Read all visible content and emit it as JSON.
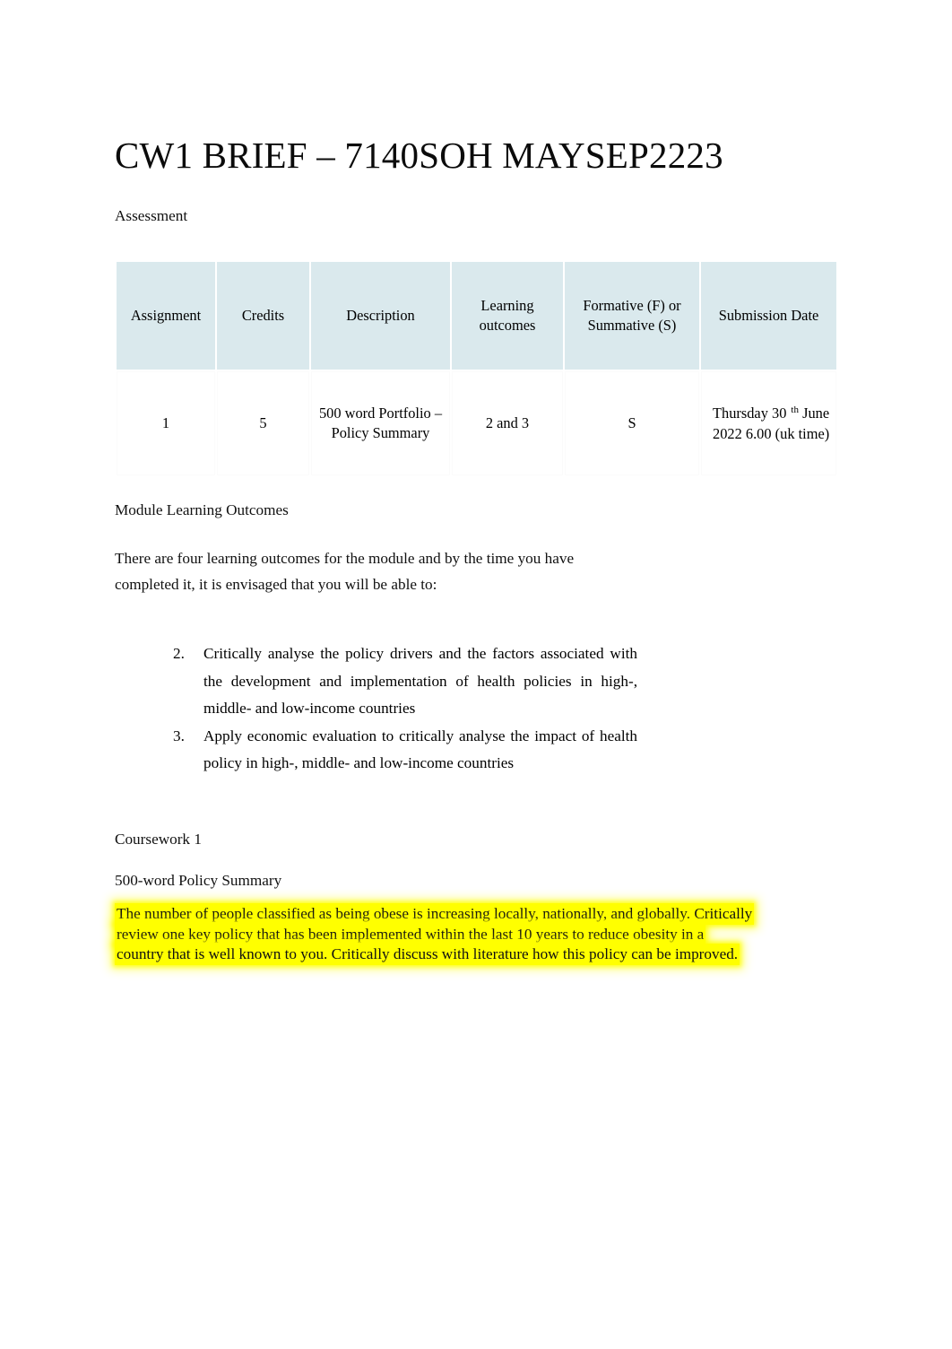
{
  "document": {
    "title": "CW1 BRIEF – 7140SOH MAYSEP2223",
    "section_assessment_label": "Assessment",
    "section_mlo_heading": "Module Learning Outcomes",
    "intro_paragraph": "There are four learning outcomes for the module and by the time you have completed it, it is envisaged that you will be able to:",
    "coursework_label": "Coursework 1",
    "policy_summary_label": "500-word Policy Summary",
    "brief_text": "The number of people classified as being obese is increasing locally, nationally, and globally. Critically review one key policy that has been implemented within the last 10 years to reduce obesity in a country that is well known to you. Critically discuss with literature how this policy can be improved."
  },
  "assessment_table": {
    "headers": [
      "Assignment",
      "Credits",
      "Description",
      "Learning outcomes",
      "Formative (F) or Summative (S)",
      "Submission Date"
    ],
    "rows": [
      {
        "assignment": "1",
        "credits": "5",
        "description": "500 word Portfolio – Policy Summary",
        "learning_outcomes": "2 and 3",
        "formative_or_summative": "S",
        "submission_date_main": "Thursday 30",
        "submission_date_sup": "th",
        "submission_date_rest": "June 2022 6.00 (uk time)"
      }
    ]
  },
  "learning_outcomes": [
    {
      "number": "2.",
      "text": "Critically analyse the policy drivers and the factors associated with the development and implementation of health policies in high-, middle- and low-income countries"
    },
    {
      "number": "3.",
      "text": "Apply economic evaluation to critically analyse the impact of health policy in high-, middle- and low-income countries"
    }
  ],
  "colors": {
    "table_header_background": "#dae9ed",
    "highlight": "#ffff00",
    "page_background": "#ffffff",
    "text": "#111111"
  }
}
